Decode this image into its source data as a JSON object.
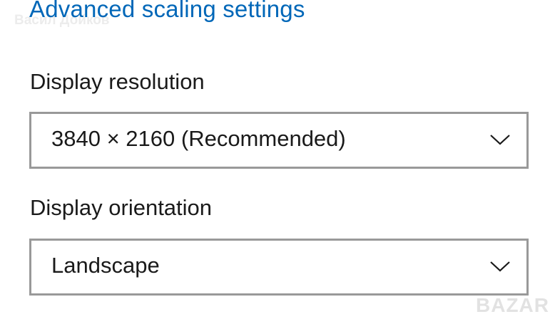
{
  "advanced_scaling_link": "Advanced scaling settings",
  "watermark_top": "Васил Дойков",
  "resolution": {
    "label": "Display resolution",
    "value": "3840 × 2160 (Recommended)",
    "icon": "chevron-down-icon"
  },
  "orientation": {
    "label": "Display orientation",
    "value": "Landscape",
    "icon": "chevron-down-icon"
  },
  "watermark_bottom": "BAZAR",
  "colors": {
    "link": "#0067b8",
    "text": "#1a1a1a",
    "border": "#999999"
  }
}
